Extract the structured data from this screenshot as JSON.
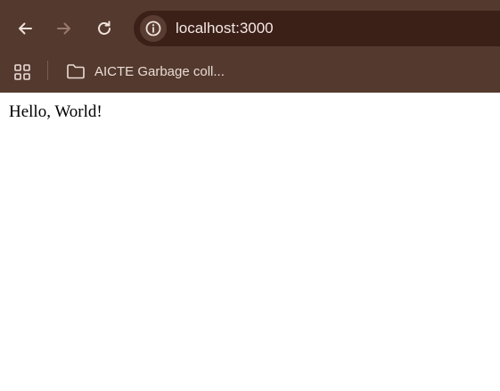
{
  "browser": {
    "address_bar": {
      "url": "localhost:3000"
    },
    "bookmarks": [
      {
        "label": "AICTE Garbage coll...",
        "icon": "folder-icon"
      }
    ],
    "colors": {
      "chrome_background": "#54392e",
      "omnibox_background": "#3b2018",
      "icon_active": "#f0e2db",
      "icon_disabled": "#9a7a6c"
    }
  },
  "page": {
    "text": "Hello, World!"
  }
}
